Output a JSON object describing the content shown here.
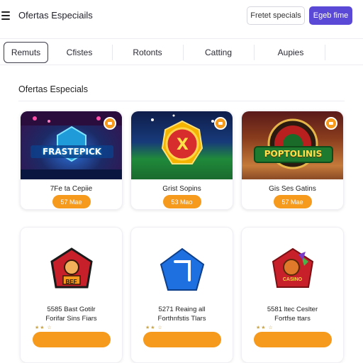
{
  "header": {
    "title": "Ofertas Especiails",
    "secondary_button": "Fretet specials",
    "primary_button": "Egeb fime"
  },
  "tabs": [
    {
      "label": "Remuts",
      "active": true
    },
    {
      "label": "Cfistes",
      "active": false
    },
    {
      "label": "Rotonts",
      "active": false
    },
    {
      "label": "Catting",
      "active": false
    },
    {
      "label": "Aupies",
      "active": false
    }
  ],
  "section": {
    "title": "Ofertas Especials"
  },
  "featured_cards": [
    {
      "art_text": "FRASTEPICK",
      "name": "7Fe ta Cepiie",
      "button": "57 Mae",
      "icon": "ticket-icon"
    },
    {
      "art_text": "X",
      "name": "Grist Sopins",
      "button": "53 Mao",
      "icon": "ticket-icon"
    },
    {
      "art_text": "POPTOLINIS",
      "name": "Gis Ses Gatins",
      "button": "57 Mae",
      "icon": "ticket-icon"
    }
  ],
  "offer_cards": [
    {
      "emblem_text": "BEF",
      "line1": "5585 Bast Gotilr",
      "line2": "Forifar Sins Fiars",
      "rating": "★★ ☆",
      "button": "",
      "emblem_icon": "mascot-emblem-icon"
    },
    {
      "emblem_text": "",
      "line1": "5271 Reaing all",
      "line2": "Forthnfstis Tlars",
      "rating": "★★ ☆",
      "button": "",
      "emblem_icon": "blue-pentagon-icon"
    },
    {
      "emblem_text": "CASINO",
      "line1": "5581 ltec Ceslter",
      "line2": "Fortfse ttars",
      "rating": "★★ ☆",
      "button": "",
      "emblem_icon": "chicken-emblem-icon"
    }
  ],
  "colors": {
    "accent": "#f59a1c",
    "primary": "#5a48d6"
  }
}
